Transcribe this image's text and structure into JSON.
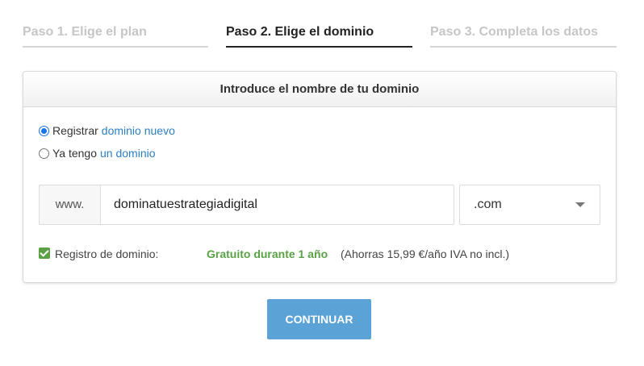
{
  "steps": [
    {
      "label": "Paso 1. Elige el plan",
      "state": "inactive"
    },
    {
      "label": "Paso 2. Elige el dominio",
      "state": "active"
    },
    {
      "label": "Paso 3. Completa los datos",
      "state": "inactive"
    }
  ],
  "card": {
    "title": "Introduce el nombre de tu dominio",
    "options": [
      {
        "prefix": "Registrar",
        "link": "dominio nuevo",
        "checked": true
      },
      {
        "prefix": "Ya tengo",
        "link": "un dominio",
        "checked": false
      }
    ],
    "domain": {
      "prefix": "www.",
      "value": "dominatuestrategiadigital",
      "tld": ".com"
    },
    "registration": {
      "checked": true,
      "label": "Registro de dominio:",
      "offer": "Gratuito durante 1 año",
      "note": "(Ahorras 15,99 €/año IVA no incl.)"
    }
  },
  "actions": {
    "continue_label": "CONTINUAR"
  },
  "colors": {
    "accent_blue": "#5ba3d6",
    "link_blue": "#2b7fc4",
    "success_green": "#5aa145"
  }
}
